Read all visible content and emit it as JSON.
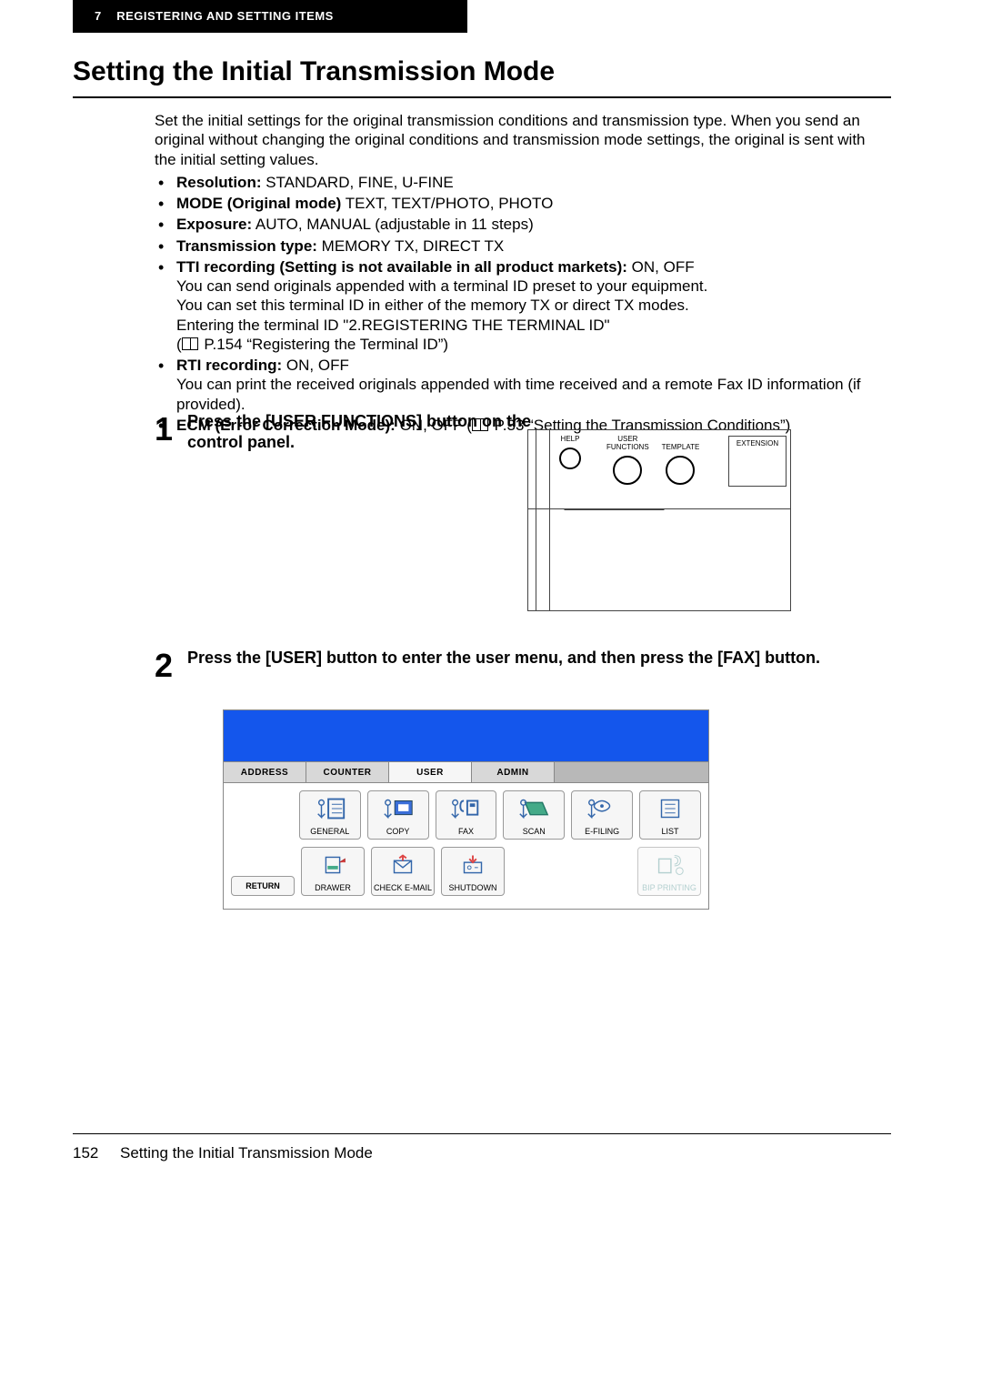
{
  "chapter": {
    "number": "7",
    "title": "REGISTERING AND SETTING ITEMS"
  },
  "section_title": "Setting the Initial Transmission Mode",
  "intro": "Set the initial settings for the original transmission conditions and transmission type. When you send an original without changing the original conditions and transmission mode settings, the original is sent with the initial setting values.",
  "bullets": {
    "resolution": {
      "label": "Resolution:",
      "value": " STANDARD, FINE, U-FINE"
    },
    "mode": {
      "label": "MODE (Original mode)",
      "value": " TEXT, TEXT/PHOTO, PHOTO"
    },
    "exposure": {
      "label": "Exposure:",
      "value": " AUTO, MANUAL (adjustable in 11 steps)"
    },
    "txtype": {
      "label": "Transmission type:",
      "value": " MEMORY TX, DIRECT TX"
    },
    "tti": {
      "label": "TTI recording (Setting is not available in all product markets):",
      "value": " ON, OFF",
      "line1": "You can send originals appended with a terminal ID preset to your equipment.",
      "line2": "You can set this terminal ID in either of the memory TX or direct TX modes.",
      "line3": "Entering the terminal ID \"2.REGISTERING THE TERMINAL ID\"",
      "ref": " P.154 “Registering the Terminal ID”)"
    },
    "rti": {
      "label": "RTI recording:",
      "value": " ON, OFF",
      "desc": "You can print the received originals appended with time received and a remote Fax ID information (if provided)."
    },
    "ecm": {
      "label": "ECM (Error Correction Mode):",
      "value": " ON, OFF (",
      "ref": " P.33 “Setting the Transmission Conditions”)"
    }
  },
  "steps": {
    "s1": {
      "num": "1",
      "text": "Press the [USER FUNCTIONS] button on the control panel."
    },
    "s2": {
      "num": "2",
      "text": "Press the [USER] button to enter the user menu, and then press the [FAX] button."
    }
  },
  "panel": {
    "help": "HELP",
    "user_functions_l1": "USER",
    "user_functions_l2": "FUNCTIONS",
    "template": "TEMPLATE",
    "extension": "EXTENSION"
  },
  "screen": {
    "tabs": {
      "address": "ADDRESS",
      "counter": "COUNTER",
      "user": "USER",
      "admin": "ADMIN"
    },
    "row1": {
      "general": "GENERAL",
      "copy": "COPY",
      "fax": "FAX",
      "scan": "SCAN",
      "efiling": "E-FILING",
      "list": "LIST"
    },
    "row2": {
      "return": "RETURN",
      "drawer": "DRAWER",
      "check_email": "CHECK E-MAIL",
      "shutdown": "SHUTDOWN",
      "bip": "BIP PRINTING"
    }
  },
  "footer": {
    "page": "152",
    "title": "Setting the Initial Transmission Mode"
  }
}
